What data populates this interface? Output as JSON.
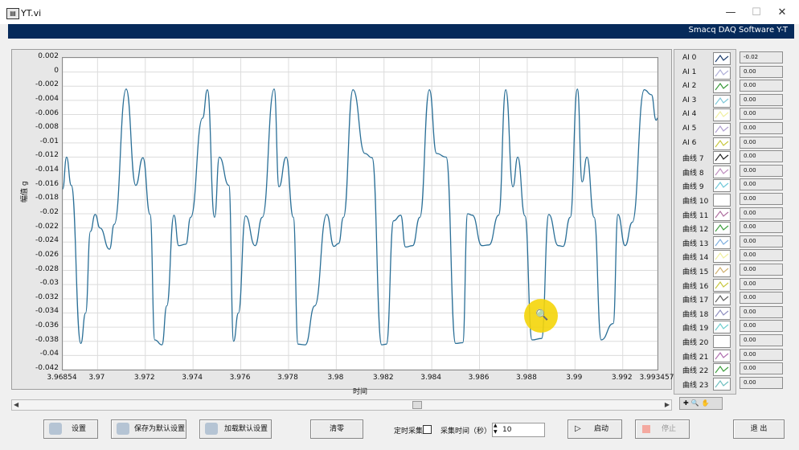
{
  "window": {
    "title": "YT.vi",
    "minimize": "—",
    "maximize": "☐",
    "close": "✕"
  },
  "banner": "Smacq DAQ Software Y-T",
  "chart_data": {
    "type": "line",
    "xlabel": "时间",
    "ylabel": "幅值 g",
    "ylim": [
      -0.042,
      0.002
    ],
    "xlim": [
      3.96854,
      3.993457
    ],
    "y_ticks": [
      "0.002",
      "0",
      "-0.002",
      "-0.004",
      "-0.006",
      "-0.008",
      "-0.01",
      "-0.012",
      "-0.014",
      "-0.016",
      "-0.018",
      "-0.02",
      "-0.022",
      "-0.024",
      "-0.026",
      "-0.028",
      "-0.03",
      "-0.032",
      "-0.034",
      "-0.036",
      "-0.038",
      "-0.04",
      "-0.042"
    ],
    "x_ticks": [
      "3.96854",
      "3.97",
      "3.972",
      "3.974",
      "3.976",
      "3.978",
      "3.98",
      "3.982",
      "3.984",
      "3.986",
      "3.988",
      "3.99",
      "3.992",
      "3.993457"
    ],
    "grid": true,
    "series": [
      {
        "name": "AI 0",
        "color": "#2a6f97",
        "x": [
          3.96854,
          3.9687,
          3.9689,
          3.9693,
          3.9695,
          3.9697,
          3.9699,
          3.9701,
          3.9705,
          3.9707,
          3.9712,
          3.9716,
          3.9719,
          3.9722,
          3.9724,
          3.9727,
          3.9729,
          3.9732,
          3.9734,
          3.9737,
          3.9739,
          3.9744,
          3.9746,
          3.9749,
          3.9751,
          3.9755,
          3.9757,
          3.9759,
          3.9762,
          3.9766,
          3.9769,
          3.9774,
          3.9776,
          3.9779,
          3.9782,
          3.9784,
          3.9787,
          3.9791,
          3.9796,
          3.9799,
          3.9801,
          3.9803,
          3.9807,
          3.9812,
          3.9815,
          3.9819,
          3.9821,
          3.9824,
          3.9827,
          3.9829,
          3.9832,
          3.9835,
          3.9839,
          3.9842,
          3.9846,
          3.985,
          3.9853,
          3.9855,
          3.9857,
          3.9861,
          3.9864,
          3.9868,
          3.9871,
          3.9874,
          3.9876,
          3.9879,
          3.9882,
          3.9886,
          3.9889,
          3.9893,
          3.9895,
          3.9898,
          3.9901,
          3.9903,
          3.9905,
          3.9908,
          3.9911,
          3.9916,
          3.9918,
          3.9921,
          3.9924,
          3.9929,
          3.9932,
          3.9934,
          3.993457
        ],
        "y": [
          -0.0165,
          -0.012,
          -0.016,
          -0.0383,
          -0.034,
          -0.0225,
          -0.0201,
          -0.022,
          -0.025,
          -0.0215,
          -0.0024,
          -0.016,
          -0.0121,
          -0.0201,
          -0.0378,
          -0.0385,
          -0.033,
          -0.0202,
          -0.0245,
          -0.0243,
          -0.0205,
          -0.0065,
          -0.0025,
          -0.0205,
          -0.012,
          -0.016,
          -0.038,
          -0.034,
          -0.0203,
          -0.0245,
          -0.0205,
          -0.0024,
          -0.0162,
          -0.012,
          -0.0205,
          -0.0384,
          -0.0385,
          -0.033,
          -0.0201,
          -0.0246,
          -0.0242,
          -0.0205,
          -0.0025,
          -0.0115,
          -0.0121,
          -0.0385,
          -0.0384,
          -0.021,
          -0.0202,
          -0.0247,
          -0.0245,
          -0.0205,
          -0.0025,
          -0.0115,
          -0.012,
          -0.0383,
          -0.0382,
          -0.02,
          -0.0202,
          -0.0245,
          -0.0244,
          -0.0202,
          -0.0025,
          -0.0162,
          -0.012,
          -0.0203,
          -0.0378,
          -0.0376,
          -0.0201,
          -0.0245,
          -0.0246,
          -0.0205,
          -0.0024,
          -0.0155,
          -0.012,
          -0.0205,
          -0.0378,
          -0.0355,
          -0.0201,
          -0.0245,
          -0.0212,
          -0.0025,
          -0.0032,
          -0.0068,
          -0.0065
        ]
      }
    ]
  },
  "legend": {
    "items": [
      "AI 0",
      "AI 1",
      "AI 2",
      "AI 3",
      "AI 4",
      "AI 5",
      "AI 6",
      "曲线 7",
      "曲线 8",
      "曲线 9",
      "曲线 10",
      "曲线 11",
      "曲线 12",
      "曲线 13",
      "曲线 14",
      "曲线 15",
      "曲线 16",
      "曲线 17",
      "曲线 18",
      "曲线 19",
      "曲线 20",
      "曲线 21",
      "曲线 22",
      "曲线 23"
    ],
    "colors": [
      "#1e3e6e",
      "#b0b0d8",
      "#3a9a3a",
      "#7fc8d8",
      "#f0f0a0",
      "#b0a0d0",
      "#c8c840",
      "#222222",
      "#c090c0",
      "#70c8d8",
      "#ffffff",
      "#b070a0",
      "#40a040",
      "#80b0e0",
      "#f0f0a0",
      "#d0b070",
      "#c8c840",
      "#606060",
      "#9090c0",
      "#70d0d0",
      "#ffffff",
      "#b070b0",
      "#40a040",
      "#70c0c0"
    ]
  },
  "values": [
    "-0.02",
    "0.00",
    "0.00",
    "0.00",
    "0.00",
    "0.00",
    "0.00",
    "0.00",
    "0.00",
    "0.00",
    "0.00",
    "0.00",
    "0.00",
    "0.00",
    "0.00",
    "0.00",
    "0.00",
    "0.00",
    "0.00",
    "0.00",
    "0.00",
    "0.00",
    "0.00",
    "0.00"
  ],
  "toolbar": {
    "settings": "设置",
    "save_default": "保存为默认设置",
    "load_default": "加载默认设置",
    "clear": "清零",
    "timed_capture": "定时采集",
    "capture_time": "采集时间（秒）",
    "capture_time_value": "10",
    "start": "启动",
    "stop": "停止",
    "exit": "退 出"
  }
}
